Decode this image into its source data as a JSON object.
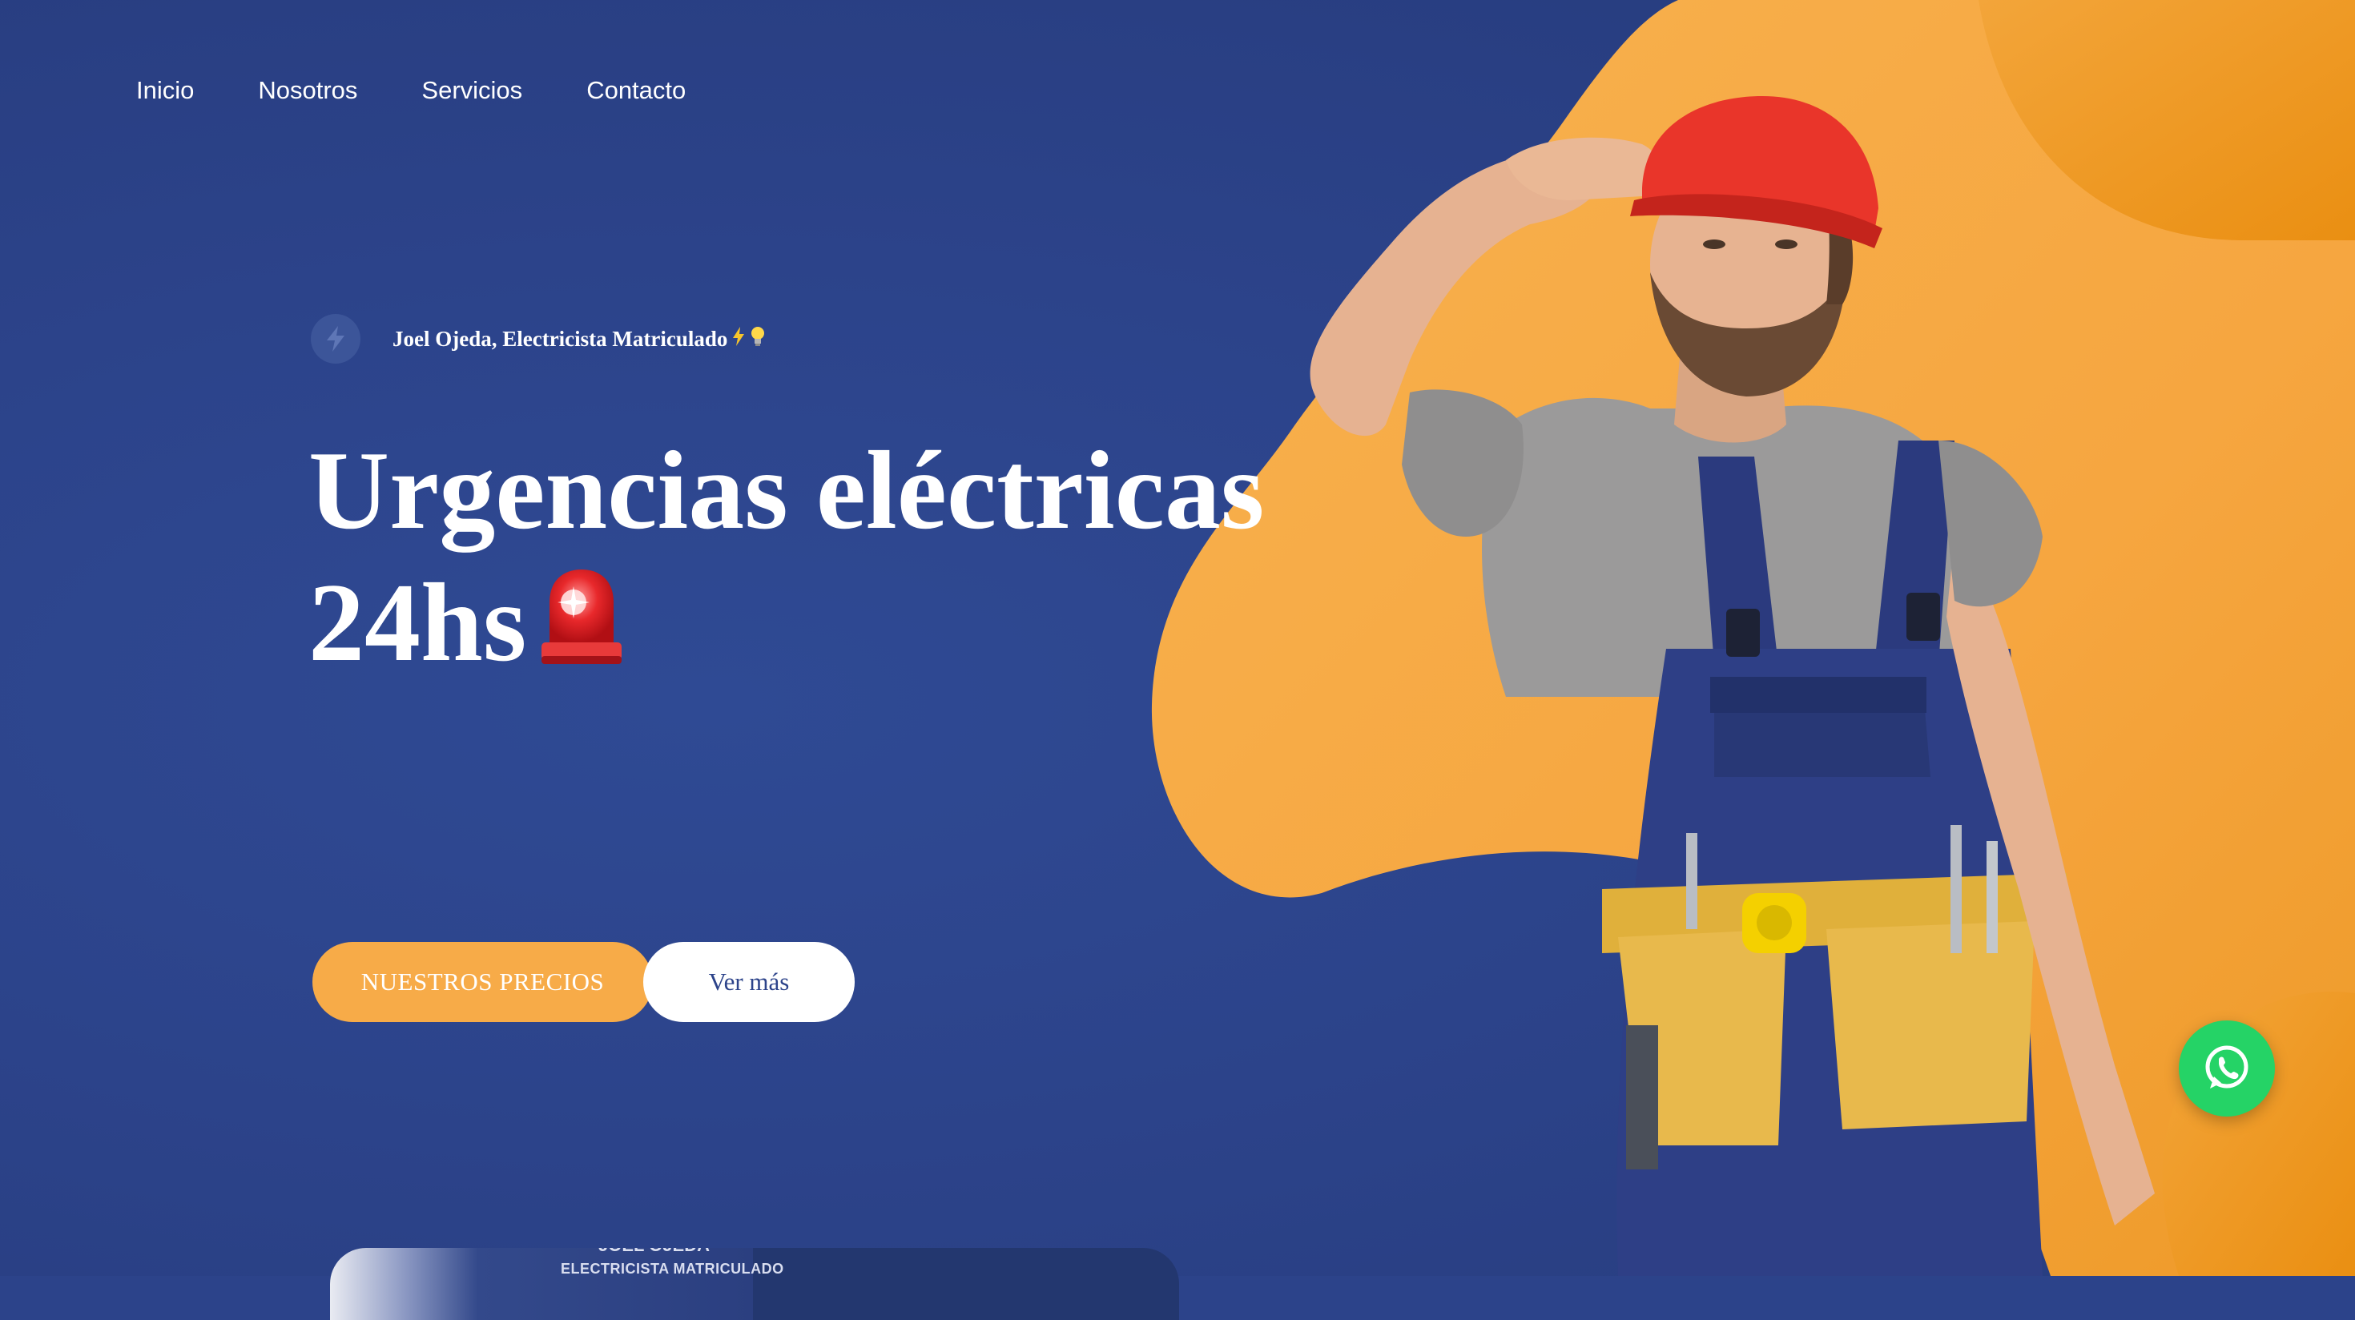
{
  "nav": {
    "items": [
      {
        "label": "Inicio"
      },
      {
        "label": "Nosotros"
      },
      {
        "label": "Servicios"
      },
      {
        "label": "Contacto"
      }
    ]
  },
  "hero": {
    "tagline": "Joel Ojeda, Electricista Matriculado",
    "tagline_icons": [
      "lightning-emoji",
      "bulb-emoji"
    ],
    "headline_line1": "Urgencias eléctricas",
    "headline_line2": "24hs",
    "headline_icon": "rotating-light-emoji",
    "primary_button": "NUESTROS PRECIOS",
    "secondary_button": "Ver más"
  },
  "preview_card": {
    "name": "JOEL OJEDA",
    "title": "ELECTRICISTA MATRICULADO"
  },
  "colors": {
    "background": "#2c438a",
    "accent_orange": "#f7ab48",
    "deep_orange": "#ef9a1f",
    "white": "#ffffff",
    "whatsapp_green": "#25d366"
  },
  "icons": {
    "badge": "lightning-bolt-icon",
    "floating_action": "whatsapp-icon"
  }
}
